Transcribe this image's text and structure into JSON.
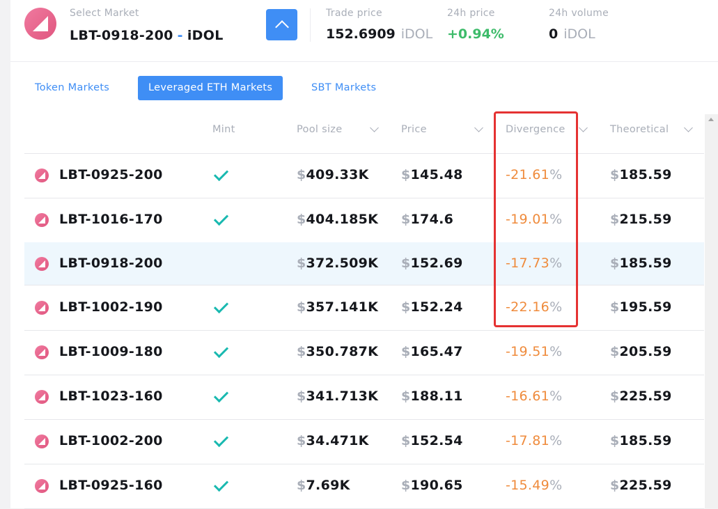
{
  "header": {
    "select_label": "Select Market",
    "market_symbol": "LBT-0918-200",
    "market_separator": "-",
    "market_quote": "iDOL",
    "stats": {
      "trade_price_label": "Trade price",
      "trade_price_value": "152.6909",
      "trade_price_unit": "iDOL",
      "change_label": "24h price",
      "change_value": "+0.94%",
      "volume_label": "24h volume",
      "volume_value": "0",
      "volume_unit": "iDOL"
    },
    "toggle_icon": "chevron-up-icon"
  },
  "tabs": [
    {
      "label": "Token Markets",
      "active": false
    },
    {
      "label": "Leveraged ETH Markets",
      "active": true
    },
    {
      "label": "SBT Markets",
      "active": false
    }
  ],
  "table": {
    "columns": {
      "mint": "Mint",
      "pool_size": "Pool size",
      "price": "Price",
      "divergence": "Divergence",
      "theoretical": "Theoretical"
    },
    "currency_symbol": "$",
    "percent_symbol": "%",
    "rows": [
      {
        "name": "LBT-0925-200",
        "mint": true,
        "pool_size": "409.33K",
        "price": "145.48",
        "divergence": "-21.61",
        "theoretical": "185.59"
      },
      {
        "name": "LBT-1016-170",
        "mint": true,
        "pool_size": "404.185K",
        "price": "174.6",
        "divergence": "-19.01",
        "theoretical": "215.59"
      },
      {
        "name": "LBT-0918-200",
        "mint": false,
        "pool_size": "372.509K",
        "price": "152.69",
        "divergence": "-17.73",
        "theoretical": "185.59",
        "highlighted": true
      },
      {
        "name": "LBT-1002-190",
        "mint": true,
        "pool_size": "357.141K",
        "price": "152.24",
        "divergence": "-22.16",
        "theoretical": "195.59"
      },
      {
        "name": "LBT-1009-180",
        "mint": true,
        "pool_size": "350.787K",
        "price": "165.47",
        "divergence": "-19.51",
        "theoretical": "205.59"
      },
      {
        "name": "LBT-1023-160",
        "mint": true,
        "pool_size": "341.713K",
        "price": "188.11",
        "divergence": "-16.61",
        "theoretical": "225.59"
      },
      {
        "name": "LBT-1002-200",
        "mint": true,
        "pool_size": "34.471K",
        "price": "152.54",
        "divergence": "-17.81",
        "theoretical": "185.59"
      },
      {
        "name": "LBT-0925-160",
        "mint": true,
        "pool_size": "7.69K",
        "price": "190.65",
        "divergence": "-15.49",
        "theoretical": "225.59"
      }
    ]
  },
  "colors": {
    "accent": "#3f8ef5",
    "positive": "#3dbb6a",
    "divergence": "#ef8b3c",
    "mint_check": "#19b9b0",
    "annotation": "#e53232",
    "highlight_row": "#eef7fd"
  }
}
